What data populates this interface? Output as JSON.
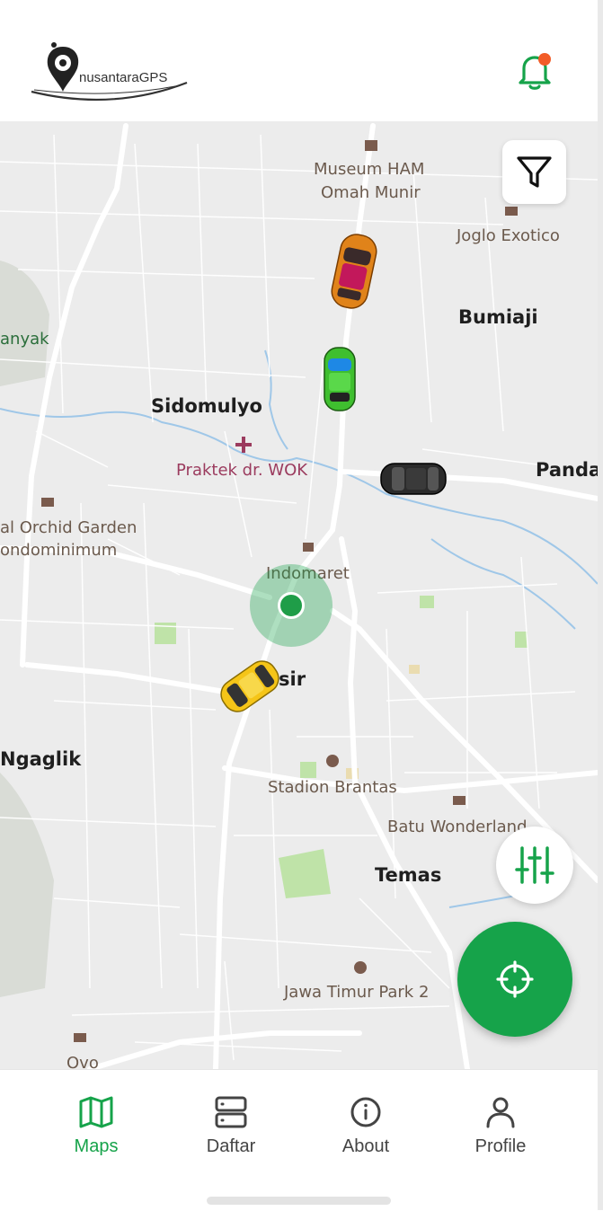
{
  "app": {
    "brand": "nusantaraGPS",
    "accent": "#16a34a",
    "notification_dot": "#f25c27"
  },
  "map": {
    "places": [
      {
        "id": "museum",
        "line1": "Museum HAM",
        "line2": "Omah Munir"
      },
      {
        "id": "joglo",
        "text": "Joglo Exotico"
      },
      {
        "id": "bumiaji",
        "text": "Bumiaji"
      },
      {
        "id": "anyak",
        "text": "anyak"
      },
      {
        "id": "sidomulyo",
        "text": "Sidomulyo"
      },
      {
        "id": "praktek",
        "text": "Praktek dr. WOK"
      },
      {
        "id": "panda",
        "text": "Panda"
      },
      {
        "id": "orchid",
        "line1": "al Orchid Garden",
        "line2": "ondominimum"
      },
      {
        "id": "indomaret",
        "text": "Indomaret"
      },
      {
        "id": "sisir",
        "text": "sir"
      },
      {
        "id": "ngaglik",
        "text": "Ngaglik"
      },
      {
        "id": "stadion",
        "text": "Stadion Brantas"
      },
      {
        "id": "batu",
        "text": "Batu Wonderland"
      },
      {
        "id": "temas",
        "text": "Temas"
      },
      {
        "id": "jatim",
        "text": "Jawa Timur Park 2"
      },
      {
        "id": "ovo",
        "text": "Ovo"
      }
    ],
    "vehicles": [
      {
        "color": "orange",
        "body": "#e0831a",
        "roof": "#c2185b"
      },
      {
        "color": "green",
        "body": "#3fbf2f",
        "roof": "#1e88e5"
      },
      {
        "color": "black",
        "body": "#2b2b2b",
        "roof": "#555555"
      },
      {
        "color": "yellow",
        "body": "#f5c518",
        "roof": "#333333"
      }
    ]
  },
  "controls": {
    "filter_icon": "funnel-icon",
    "adjust_icon": "sliders-icon",
    "locate_icon": "crosshair-icon",
    "notification_icon": "bell-icon"
  },
  "nav": {
    "items": [
      {
        "label": "Maps",
        "icon": "map-icon",
        "active": true
      },
      {
        "label": "Daftar",
        "icon": "server-icon",
        "active": false
      },
      {
        "label": "About",
        "icon": "info-icon",
        "active": false
      },
      {
        "label": "Profile",
        "icon": "user-icon",
        "active": false
      }
    ]
  }
}
